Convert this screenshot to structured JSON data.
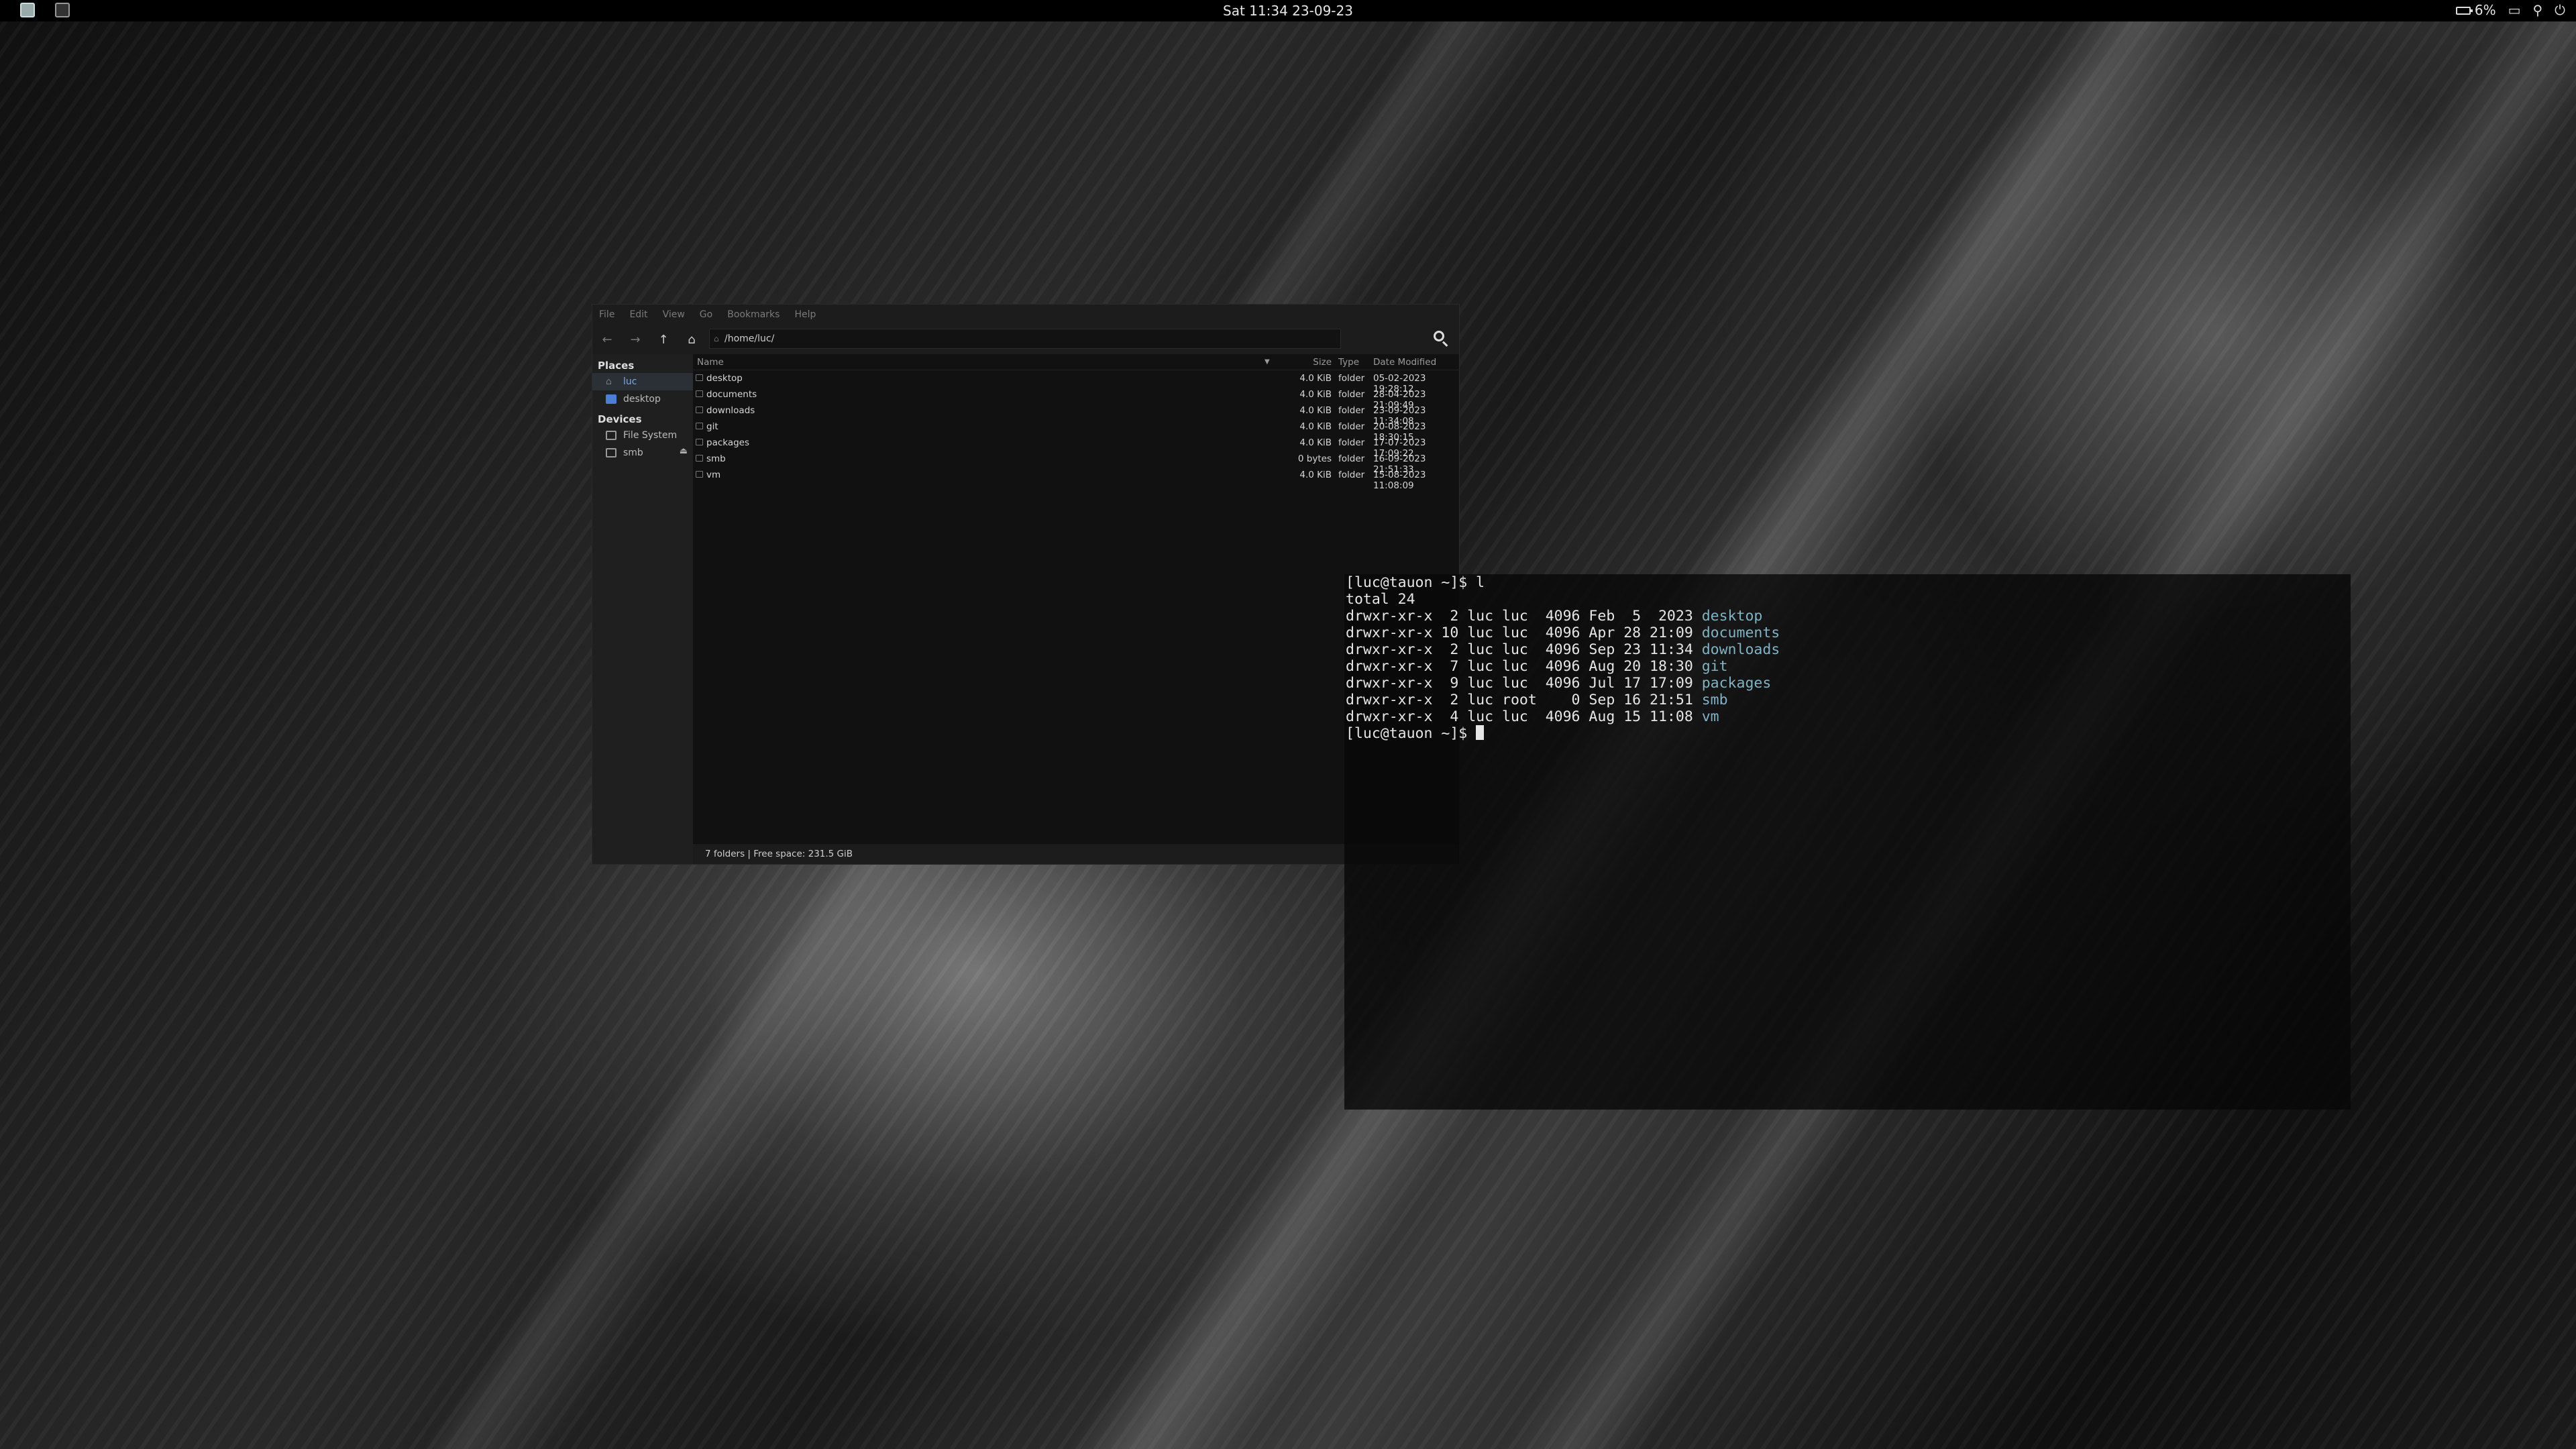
{
  "topbar": {
    "clock": "Sat  11:34  23-09-23",
    "battery": "6%"
  },
  "file_manager": {
    "menu": [
      "File",
      "Edit",
      "View",
      "Go",
      "Bookmarks",
      "Help"
    ],
    "path": "/home/luc/",
    "places_header": "Places",
    "places": [
      {
        "label": "luc",
        "selected": true
      },
      {
        "label": "desktop",
        "selected": false
      }
    ],
    "devices_header": "Devices",
    "devices": [
      {
        "label": "File System"
      },
      {
        "label": "smb"
      }
    ],
    "columns": {
      "name": "Name",
      "size": "Size",
      "type": "Type",
      "date": "Date Modified"
    },
    "rows": [
      {
        "name": "desktop",
        "size": "4.0 KiB",
        "type": "folder",
        "date": "05-02-2023 19:28:12"
      },
      {
        "name": "documents",
        "size": "4.0 KiB",
        "type": "folder",
        "date": "28-04-2023 21:09:49"
      },
      {
        "name": "downloads",
        "size": "4.0 KiB",
        "type": "folder",
        "date": "23-09-2023 11:34:08"
      },
      {
        "name": "git",
        "size": "4.0 KiB",
        "type": "folder",
        "date": "20-08-2023 18:30:15"
      },
      {
        "name": "packages",
        "size": "4.0 KiB",
        "type": "folder",
        "date": "17-07-2023 17:09:22"
      },
      {
        "name": "smb",
        "size": "0 bytes",
        "type": "folder",
        "date": "16-09-2023 21:51:33"
      },
      {
        "name": "vm",
        "size": "4.0 KiB",
        "type": "folder",
        "date": "15-08-2023 11:08:09"
      }
    ],
    "status": "7 folders  |  Free space: 231.5 GiB"
  },
  "terminal": {
    "prompt": "[luc@tauon ~]$ ",
    "command": "l",
    "total": "total 24",
    "entries": [
      {
        "prefix": "drwxr-xr-x  2 luc luc  4096 Feb  5  2023 ",
        "name": "desktop"
      },
      {
        "prefix": "drwxr-xr-x 10 luc luc  4096 Apr 28 21:09 ",
        "name": "documents"
      },
      {
        "prefix": "drwxr-xr-x  2 luc luc  4096 Sep 23 11:34 ",
        "name": "downloads"
      },
      {
        "prefix": "drwxr-xr-x  7 luc luc  4096 Aug 20 18:30 ",
        "name": "git"
      },
      {
        "prefix": "drwxr-xr-x  9 luc luc  4096 Jul 17 17:09 ",
        "name": "packages"
      },
      {
        "prefix": "drwxr-xr-x  2 luc root    0 Sep 16 21:51 ",
        "name": "smb"
      },
      {
        "prefix": "drwxr-xr-x  4 luc luc  4096 Aug 15 11:08 ",
        "name": "vm"
      }
    ],
    "last_prompt": "[luc@tauon ~]$ "
  }
}
